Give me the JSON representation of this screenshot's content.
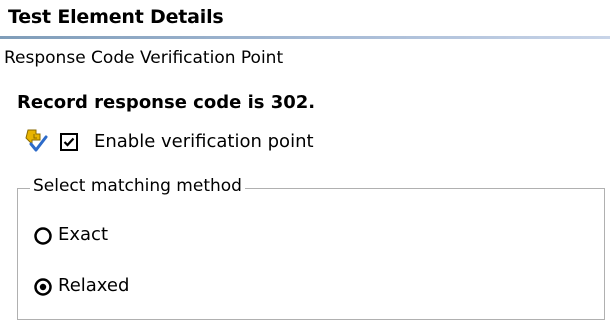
{
  "section": {
    "title": "Test Element Details"
  },
  "subsection": {
    "title": "Response Code Verification Point"
  },
  "record": {
    "text": "Record response code is 302."
  },
  "verification": {
    "icon": "verification-point-icon",
    "checkbox_label": "Enable verification point",
    "checked": true
  },
  "matching": {
    "legend": "Select matching method",
    "options": [
      {
        "label": "Exact",
        "selected": false
      },
      {
        "label": "Relaxed",
        "selected": true
      }
    ]
  },
  "colors": {
    "header_underline": "#7f9db9",
    "icon_yellow": "#e8b400",
    "icon_blue": "#2d6bc9"
  }
}
